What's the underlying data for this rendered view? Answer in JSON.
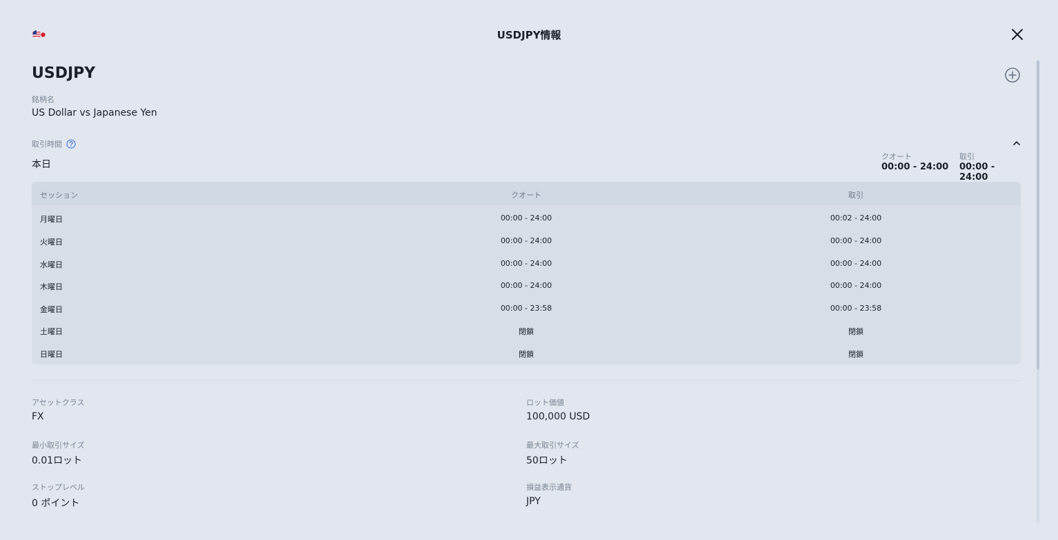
{
  "header": {
    "title": "USDJPY情報"
  },
  "symbol": "USDJPY",
  "name": {
    "label": "銘柄名",
    "value": "US Dollar vs Japanese Yen"
  },
  "trading_hours": {
    "label": "取引時間",
    "today_label": "本日",
    "today_quote_label": "クオート",
    "today_quote_value": "00:00 - 24:00",
    "today_trade_label": "取引",
    "today_trade_value": "00:00 - 24:00"
  },
  "sessions": {
    "headers": [
      "セッション",
      "クオート",
      "取引"
    ],
    "rows": [
      [
        "月曜日",
        "00:00 - 24:00",
        "00:02 - 24:00"
      ],
      [
        "火曜日",
        "00:00 - 24:00",
        "00:00 - 24:00"
      ],
      [
        "水曜日",
        "00:00 - 24:00",
        "00:00 - 24:00"
      ],
      [
        "木曜日",
        "00:00 - 24:00",
        "00:00 - 24:00"
      ],
      [
        "金曜日",
        "00:00 - 23:58",
        "00:00 - 23:58"
      ],
      [
        "土曜日",
        "閉鎖",
        "閉鎖"
      ],
      [
        "日曜日",
        "閉鎖",
        "閉鎖"
      ]
    ]
  },
  "specs": [
    {
      "label": "アセットクラス",
      "value": "FX"
    },
    {
      "label": "ロット価値",
      "value": "100,000 USD"
    },
    {
      "label": "最小取引サイズ",
      "value": "0.01ロット"
    },
    {
      "label": "最大取引サイズ",
      "value": "50ロット"
    },
    {
      "label": "ストップレベル",
      "value": "0 ポイント"
    },
    {
      "label": "損益表示通貨",
      "value": "JPY"
    }
  ],
  "icons": {
    "flag": "us-jp-flag-icon",
    "close": "close-icon",
    "add": "plus-circle-icon",
    "help": "question-circle-icon",
    "collapse": "chevron-up-icon"
  },
  "colors": {
    "background": "#e2e7ef",
    "table": "#d7dee8",
    "help_accent": "#3b6fd4"
  }
}
